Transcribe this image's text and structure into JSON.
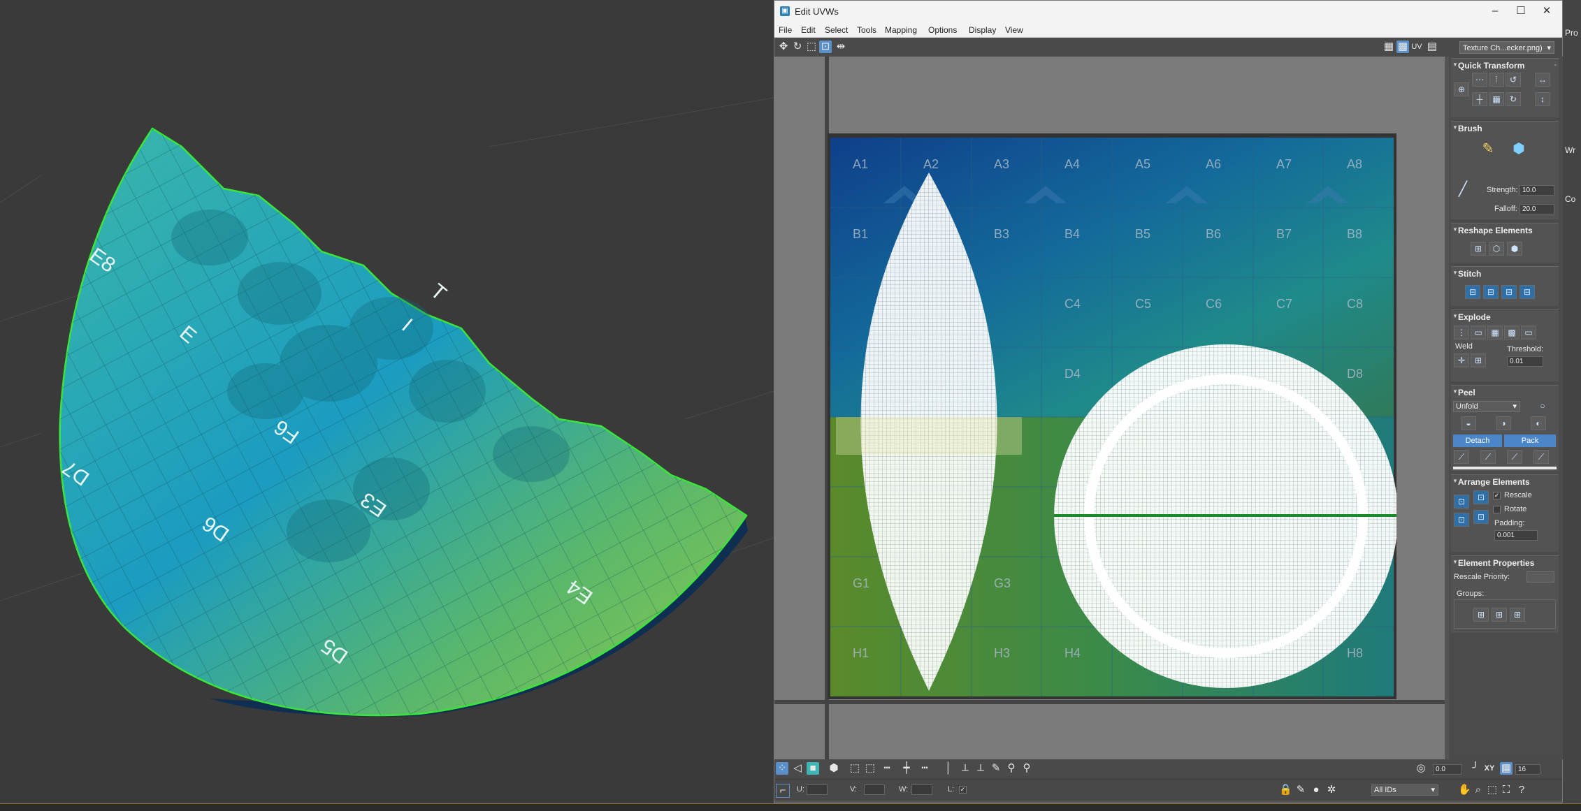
{
  "viewport": {
    "mesh_labels": [
      "E8",
      "E",
      "I",
      "T",
      "D7",
      "F6",
      "E3",
      "D6",
      "D5",
      "E4"
    ]
  },
  "window": {
    "title": "Edit UVWs",
    "controls": {
      "minimize": "–",
      "maximize": "☐",
      "close": "✕"
    }
  },
  "menu": [
    "File",
    "Edit",
    "Select",
    "Tools",
    "Mapping",
    "Options",
    "Display",
    "View"
  ],
  "toolbar": {
    "uv_label": "UV",
    "texture_dropdown": "Texture Ch...ecker.png)"
  },
  "grid": {
    "rows": [
      "A",
      "B",
      "C",
      "D",
      "E",
      "F",
      "G",
      "H"
    ],
    "visible_labels": {
      "A1": "A1",
      "A2": "A2",
      "A3": "A3",
      "A4": "A4",
      "A5": "A5",
      "A6": "A6",
      "A7": "A7",
      "A8": "A8",
      "B1": "B1",
      "B3": "B3",
      "B4": "B4",
      "B5": "B5",
      "B6": "B6",
      "B7": "B7",
      "B8": "B8",
      "C4": "C4",
      "C5": "C5",
      "C6": "C6",
      "C7": "C7",
      "C8": "C8",
      "D4": "D4",
      "D8": "D8",
      "G1": "G1",
      "G3": "G3",
      "H1": "H1",
      "H3": "H3",
      "H4": "H4",
      "H8": "H8"
    }
  },
  "panel": {
    "quick_transform": "Quick Transform",
    "brush": "Brush",
    "strength_label": "Strength:",
    "strength_value": "10.0",
    "falloff_label": "Falloff:",
    "falloff_value": "20.0",
    "reshape": "Reshape Elements",
    "stitch": "Stitch",
    "explode": "Explode",
    "weld": "Weld",
    "threshold_label": "Threshold:",
    "threshold_value": "0.01",
    "peel": "Peel",
    "unfold": "Unfold",
    "detach": "Detach",
    "pack": "Pack",
    "arrange": "Arrange Elements",
    "rescale": "Rescale",
    "rotate": "Rotate",
    "padding_label": "Padding:",
    "padding_value": "0.001",
    "element_props": "Element Properties",
    "rescale_priority": "Rescale Priority:",
    "groups": "Groups:"
  },
  "bottom": {
    "angle_value": "0.0",
    "xy_label": "XY",
    "grid_value": "16",
    "u_label": "U:",
    "v_label": "V:",
    "w_label": "W:",
    "l_label": "L:",
    "ids_dropdown": "All IDs"
  },
  "right_edge": [
    "Pro",
    "Wr",
    "Co"
  ],
  "colors": {
    "accent": "#4a86c8",
    "selection": "#39e639"
  }
}
